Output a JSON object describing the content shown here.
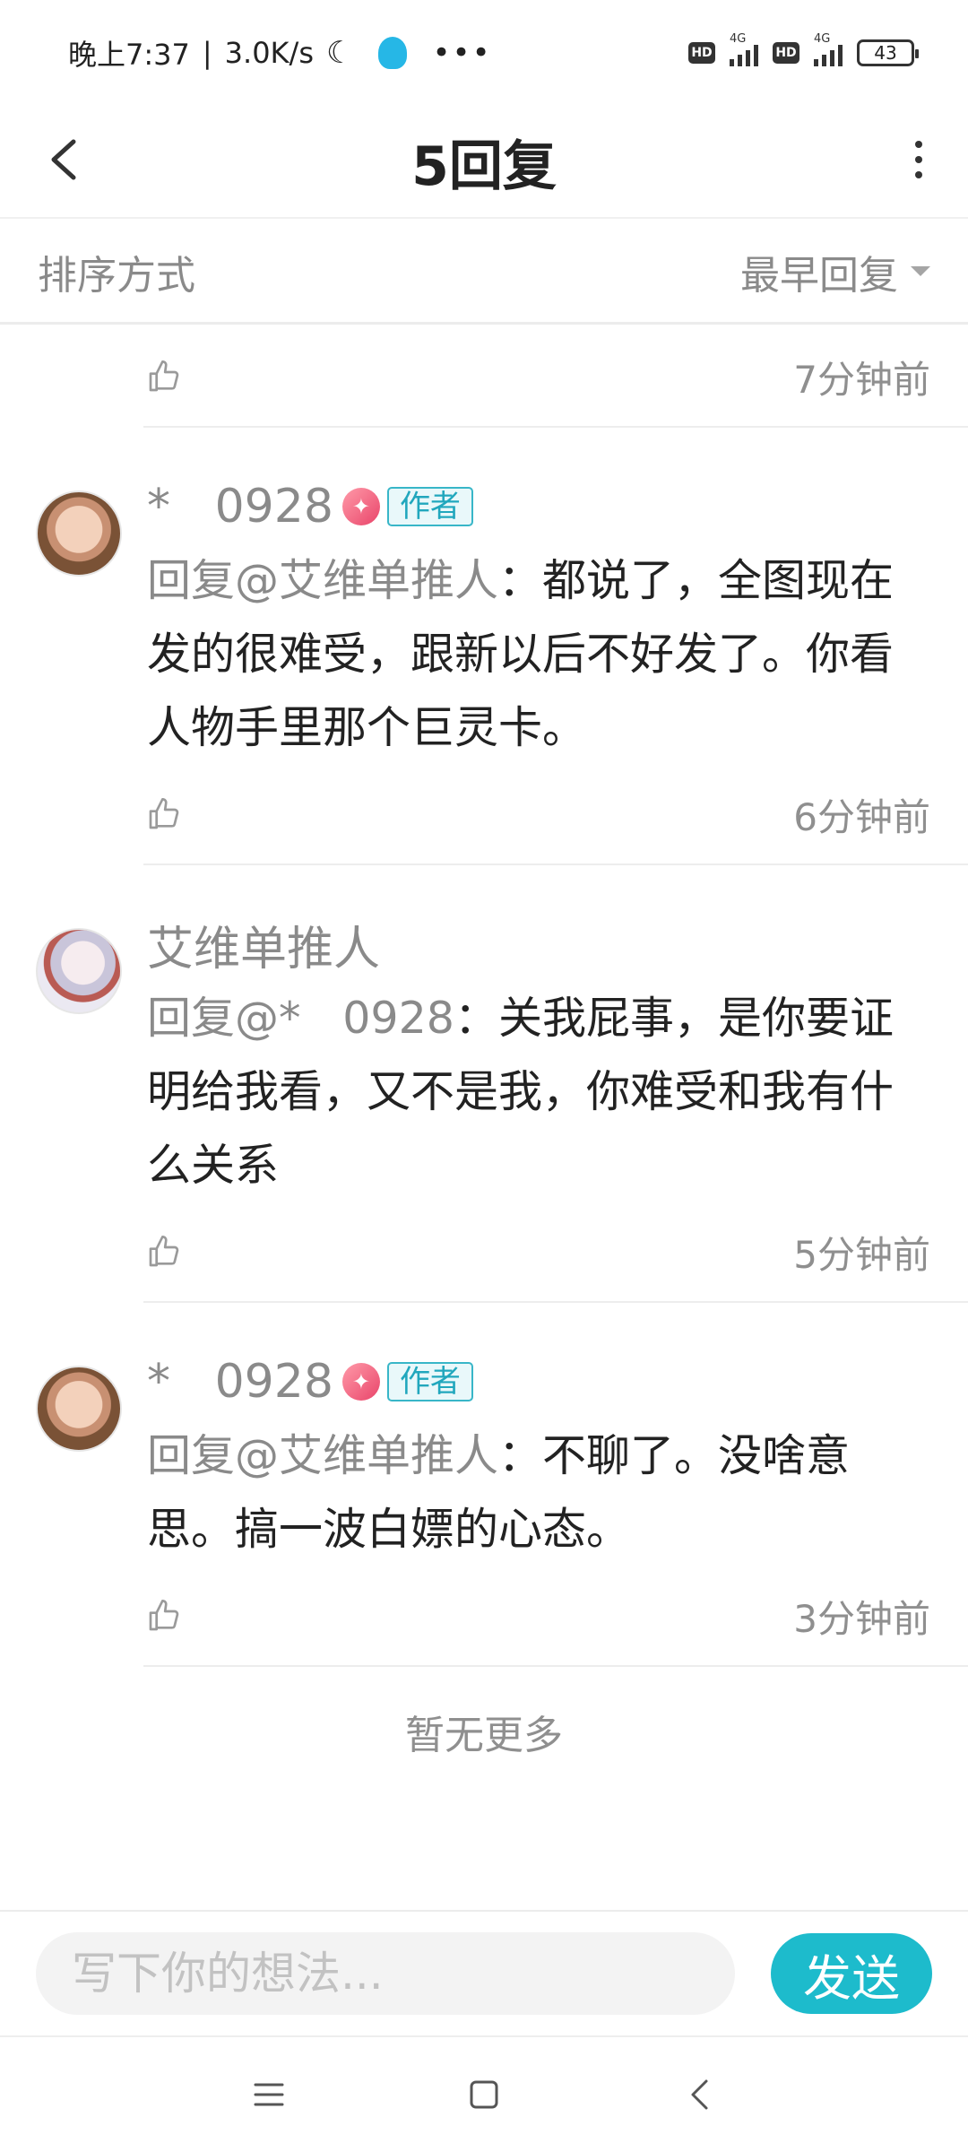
{
  "status_bar": {
    "time": "晚上7:37",
    "network_speed": "3.0K/s",
    "hd_label": "HD",
    "network_type": "4G",
    "battery": "43"
  },
  "header": {
    "title": "5回复"
  },
  "sort": {
    "label": "排序方式",
    "selected": "最早回复"
  },
  "first_meta": {
    "time": "7分钟前"
  },
  "comments": [
    {
      "username": "*   0928",
      "badge": "作者",
      "mention": "回复@艾维单推人",
      "text": "：都说了，全图现在发的很难受，跟新以后不好发了。你看人物手里那个巨灵卡。",
      "time": "6分钟前"
    },
    {
      "username": "艾维单推人",
      "mention": "回复@*   0928",
      "text": "：关我屁事，是你要证明给我看，又不是我，你难受和我有什么关系",
      "time": "5分钟前"
    },
    {
      "username": "*   0928",
      "badge": "作者",
      "mention": "回复@艾维单推人",
      "text": "：不聊了。没啥意思。搞一波白嫖的心态。",
      "time": "3分钟前"
    }
  ],
  "footer": {
    "no_more": "暂无更多"
  },
  "input": {
    "placeholder": "写下你的想法...",
    "send_label": "发送"
  },
  "colors": {
    "accent": "#1dbbcc",
    "author_badge": "#21a7bd",
    "muted_text": "#8a8a8a"
  },
  "icons": [
    "back-arrow-icon",
    "more-vertical-icon",
    "thumbs-up-icon",
    "menu-icon",
    "home-square-icon",
    "nav-back-icon"
  ]
}
